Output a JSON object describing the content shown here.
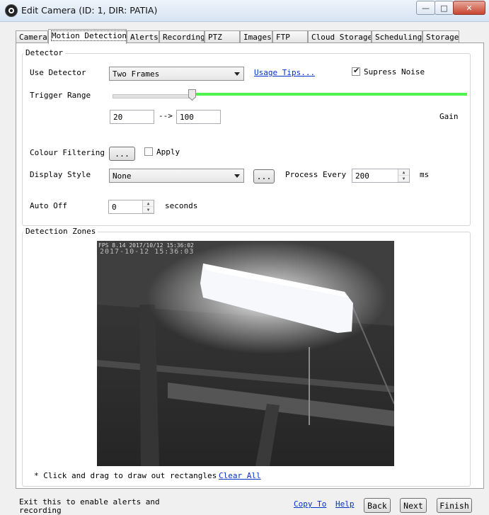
{
  "window": {
    "title": "Edit Camera (ID: 1, DIR: PATIA)",
    "minimize": "—",
    "maximize": "□",
    "close": "✕"
  },
  "tabs": [
    {
      "label": "Camera"
    },
    {
      "label": "Motion Detection",
      "active": true
    },
    {
      "label": "Alerts"
    },
    {
      "label": "Recording"
    },
    {
      "label": "PTZ"
    },
    {
      "label": "Images"
    },
    {
      "label": "FTP"
    },
    {
      "label": "Cloud Storage"
    },
    {
      "label": "Scheduling"
    },
    {
      "label": "Storage"
    }
  ],
  "detector": {
    "group_label": "Detector",
    "use_detector_label": "Use Detector",
    "use_detector_value": "Two Frames",
    "usage_tips": "Usage Tips...",
    "supress_noise_label": "Supress Noise",
    "supress_noise_checked": true,
    "trigger_range_label": "Trigger Range",
    "range_min": "20",
    "range_arrow": "-->",
    "range_max": "100",
    "gain_label": "Gain",
    "colour_filtering_label": "Colour Filtering",
    "colour_button": "...",
    "apply_label": "Apply",
    "apply_checked": false,
    "display_style_label": "Display Style",
    "display_style_value": "None",
    "display_button": "...",
    "process_every_label": "Process Every",
    "process_every_value": "200",
    "ms_label": "ms",
    "auto_off_label": "Auto Off",
    "auto_off_value": "0",
    "seconds_label": "seconds"
  },
  "zones": {
    "group_label": "Detection Zones",
    "osd_line1": "FPS 8.14 2017/10/12 15:36:02",
    "osd_line2": "2017-10-12 15:36:03",
    "hint": "* Click and drag to draw out rectangles",
    "clear_all": "Clear All"
  },
  "footer": {
    "hint": "Exit this to enable alerts and recording",
    "copy_to": "Copy To",
    "help": "Help",
    "back": "Back",
    "next": "Next",
    "finish": "Finish"
  },
  "colors": {
    "range_fill": "#4ef34e",
    "link": "#0033cc"
  }
}
